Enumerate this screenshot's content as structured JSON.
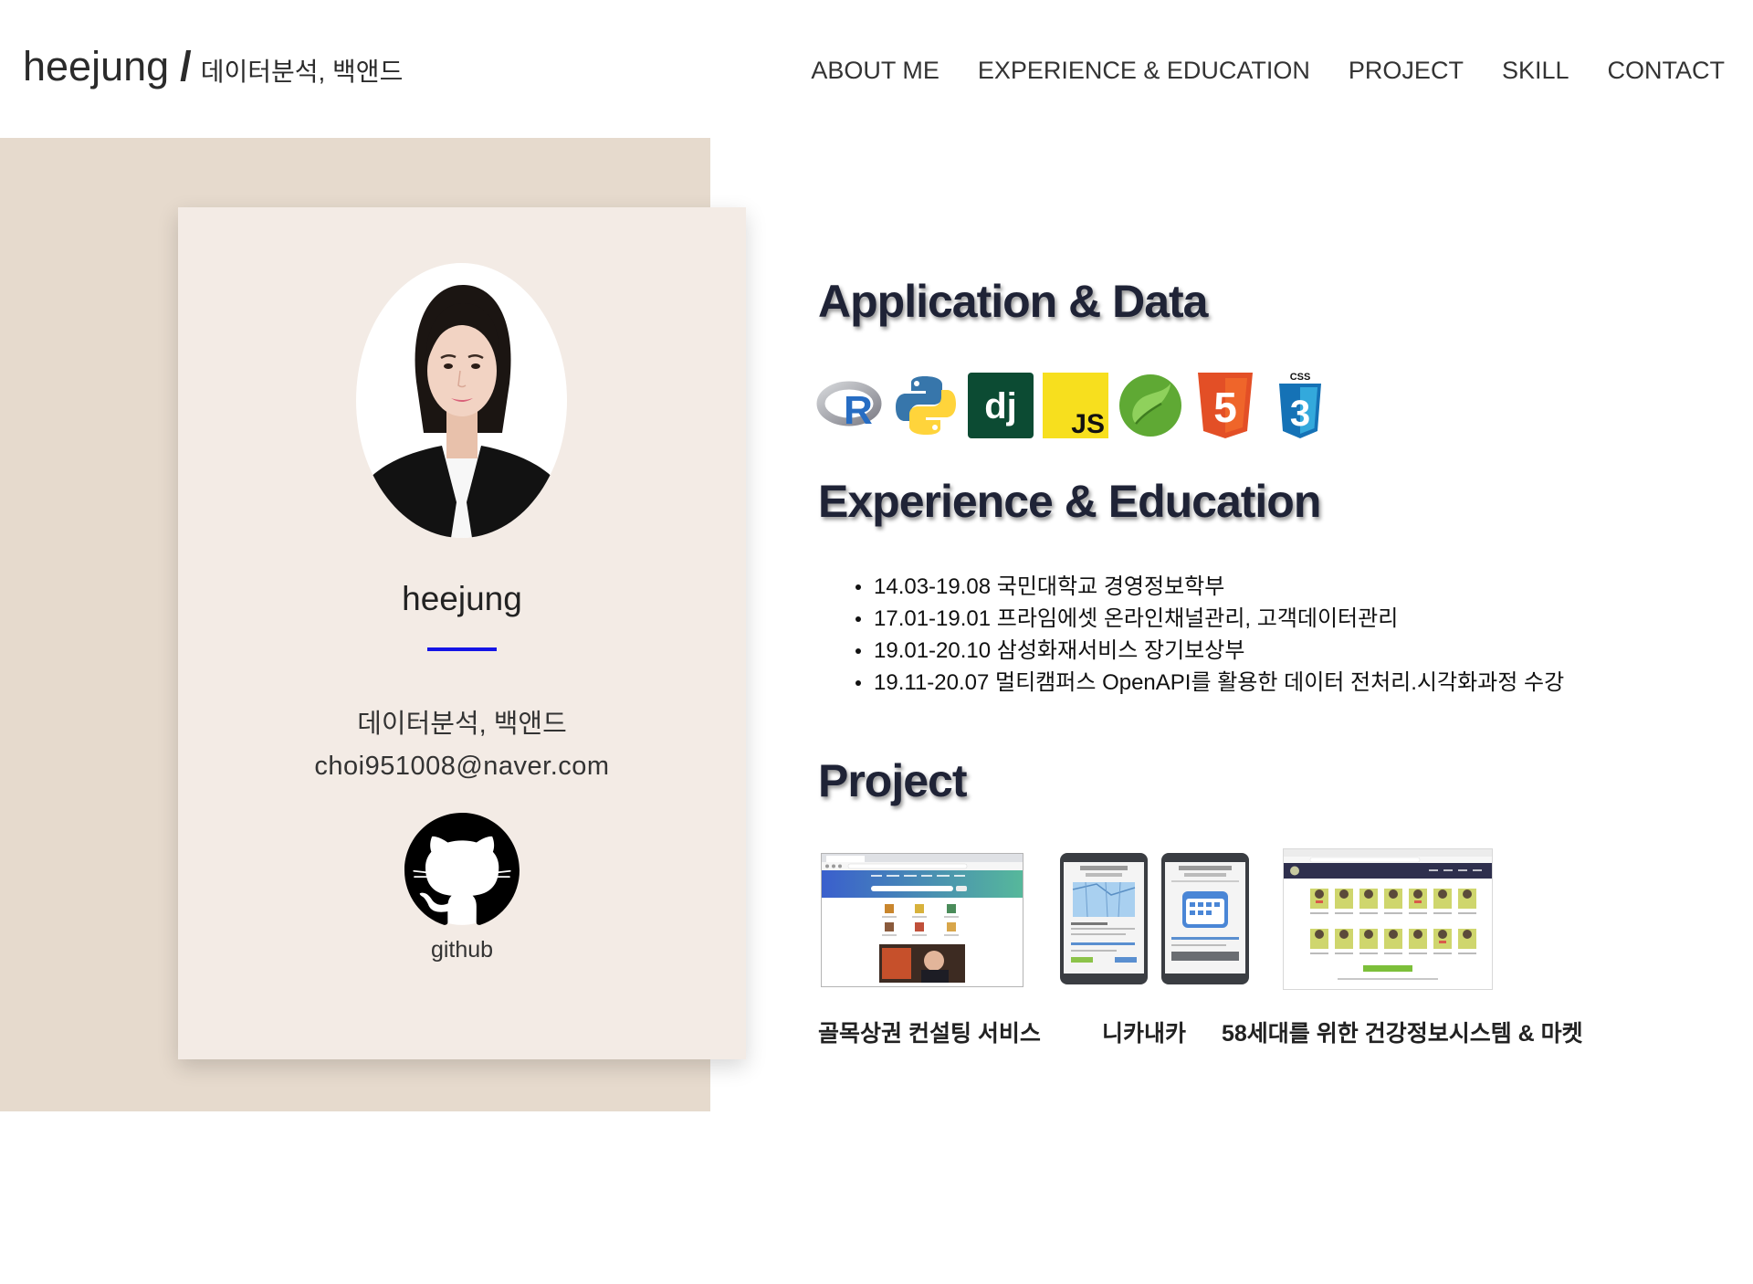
{
  "header": {
    "brand": "heejung",
    "separator": "/",
    "subtitle": "데이터분석, 백앤드"
  },
  "nav": [
    {
      "label": "ABOUT ME"
    },
    {
      "label": "EXPERIENCE & EDUCATION"
    },
    {
      "label": "PROJECT"
    },
    {
      "label": "SKILL"
    },
    {
      "label": "CONTACT"
    }
  ],
  "profile": {
    "name": "heejung",
    "role": "데이터분석, 백앤드",
    "email": "choi951008@naver.com",
    "github_label": "github",
    "github_icon": "github-icon"
  },
  "skills": {
    "heading": "Application & Data",
    "icons": [
      {
        "icon": "r-icon",
        "text": "R"
      },
      {
        "icon": "python-icon"
      },
      {
        "icon": "django-icon",
        "text": "dj"
      },
      {
        "icon": "javascript-icon",
        "text": "JS"
      },
      {
        "icon": "spring-icon"
      },
      {
        "icon": "html5-icon",
        "text": "5"
      },
      {
        "icon": "css3-icon",
        "text": "CSS",
        "number": "3"
      }
    ]
  },
  "experience": {
    "heading": "Experience & Education",
    "items": [
      "14.03-19.08 국민대학교 경영정보학부",
      "17.01-19.01 프라임에셋 온라인채널관리, 고객데이터관리",
      "19.01-20.10 삼성화재서비스 장기보상부",
      "19.11-20.07 멀티캠퍼스 OpenAPI를 활용한 데이터 전처리.시각화과정 수강"
    ]
  },
  "projects": {
    "heading": "Project",
    "items": [
      {
        "caption": "골목상권 컨설팅 서비스"
      },
      {
        "caption": "니카내카"
      },
      {
        "caption": "58세대를 위한 건강정보시스템 & 마켓"
      }
    ]
  },
  "colors": {
    "panel-bg": "#e6dacd",
    "card-bg": "#f3ebe5",
    "accent-line": "#1414e6",
    "heading": "#1f2336",
    "nav-text": "#333333"
  }
}
